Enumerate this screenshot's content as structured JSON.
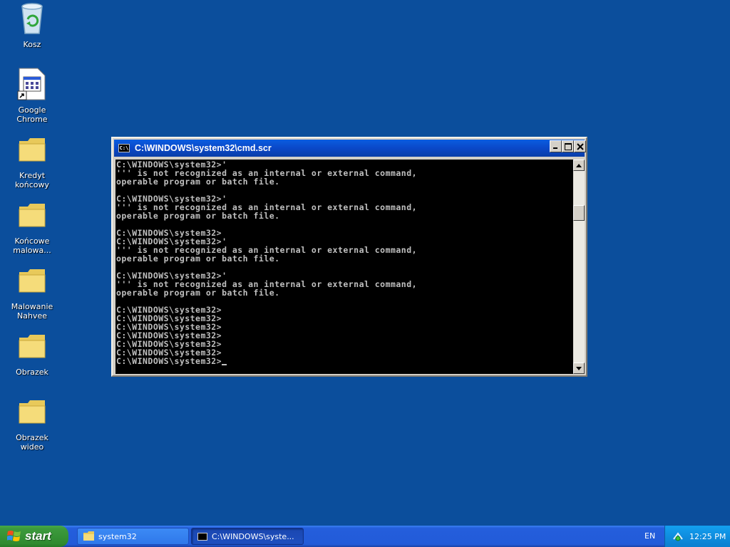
{
  "desktop": {
    "icons": [
      {
        "label": "Kosz"
      },
      {
        "label": "Google Chrome"
      },
      {
        "label": "Kredyt końcowy"
      },
      {
        "label": "Końcowe malowa..."
      },
      {
        "label": "Malowanie Nahvee"
      },
      {
        "label": "Obrazek"
      },
      {
        "label": "Obrazek wideo"
      }
    ]
  },
  "window": {
    "title": "C:\\WINDOWS\\system32\\cmd.scr",
    "icon_text": "C:\\",
    "console_lines": [
      "C:\\WINDOWS\\system32>'",
      "''' is not recognized as an internal or external command,",
      "operable program or batch file.",
      "",
      "C:\\WINDOWS\\system32>'",
      "''' is not recognized as an internal or external command,",
      "operable program or batch file.",
      "",
      "C:\\WINDOWS\\system32>",
      "C:\\WINDOWS\\system32>'",
      "''' is not recognized as an internal or external command,",
      "operable program or batch file.",
      "",
      "C:\\WINDOWS\\system32>'",
      "''' is not recognized as an internal or external command,",
      "operable program or batch file.",
      "",
      "C:\\WINDOWS\\system32>",
      "C:\\WINDOWS\\system32>",
      "C:\\WINDOWS\\system32>",
      "C:\\WINDOWS\\system32>",
      "C:\\WINDOWS\\system32>",
      "C:\\WINDOWS\\system32>",
      "C:\\WINDOWS\\system32>"
    ],
    "buttons": {
      "minimize": "minimize-icon",
      "maximize": "maximize-icon",
      "close": "close-icon"
    }
  },
  "taskbar": {
    "start_label": "start",
    "tasks": [
      {
        "label": "system32",
        "icon": "folder-icon",
        "active": false
      },
      {
        "label": "C:\\WINDOWS\\syste...",
        "icon": "cmd-icon",
        "active": true
      }
    ],
    "language": "EN",
    "clock": "12:25 PM"
  },
  "colors": {
    "desktop_bg": "#0b4e9c",
    "titlebar": "#0a48c8",
    "console_bg": "#000000",
    "console_fg": "#c0c0c0",
    "taskbar": "#245edc",
    "start": "#3c9a3c",
    "tray": "#0f8ddf"
  }
}
